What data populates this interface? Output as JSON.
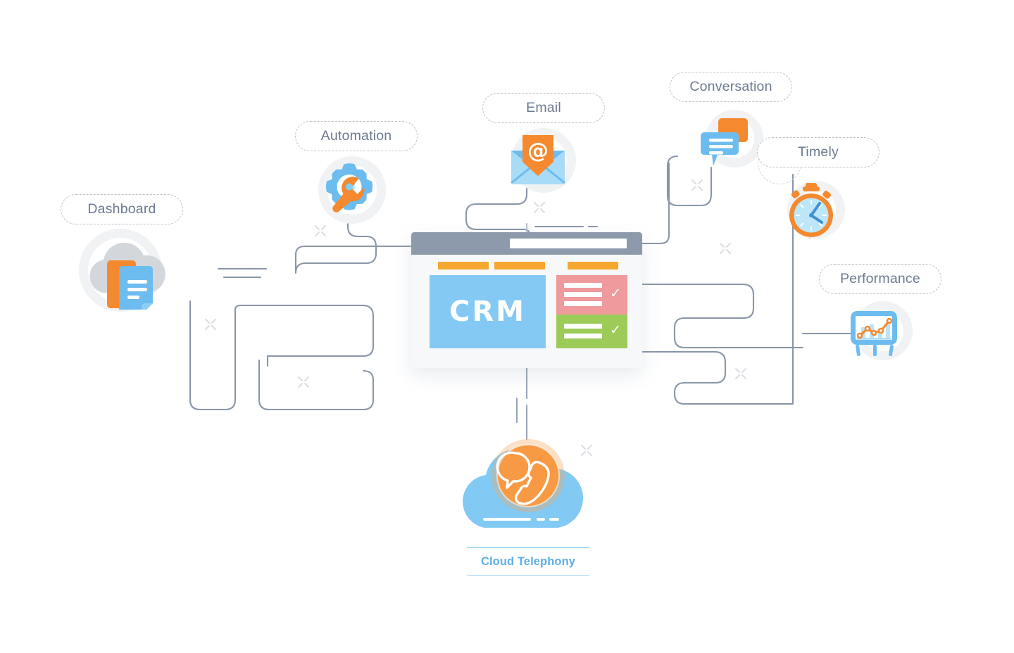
{
  "illustration": {
    "title": "CRM integration concept diagram",
    "center": {
      "app_name": "CRM",
      "window_title_bar": "",
      "address_bar_value": "",
      "tabs": [
        "",
        "",
        ""
      ],
      "panels": [
        {
          "name": "pink-task-card",
          "color": "#ef9a9c",
          "rows": 3,
          "checked": true
        },
        {
          "name": "green-task-card",
          "color": "#9ccb58",
          "rows": 2,
          "checked": true
        }
      ]
    },
    "nodes": [
      {
        "id": "dashboard",
        "label": "Dashboard",
        "icon": "cloud-documents-icon"
      },
      {
        "id": "automation",
        "label": "Automation",
        "icon": "gear-wrench-icon"
      },
      {
        "id": "email",
        "label": "Email",
        "icon": "envelope-at-icon"
      },
      {
        "id": "conversation",
        "label": "Conversation",
        "icon": "chat-bubbles-icon"
      },
      {
        "id": "timely",
        "label": "Timely",
        "icon": "stopwatch-icon"
      },
      {
        "id": "performance",
        "label": "Performance",
        "icon": "chart-easel-icon"
      }
    ],
    "footer": {
      "label": "Cloud Telephony",
      "icon": "cloud-phone-icon"
    },
    "colors": {
      "orange": "#f5892f",
      "orange_light": "#f5a730",
      "blue": "#7dc5f0",
      "blue_light": "#a9d8f6",
      "blue_text": "#5dafe8",
      "slate": "#8d9aab",
      "wire": "#8996a8",
      "pink": "#ef9a9c",
      "green": "#9ccb58",
      "pill_text": "#6b7a8f",
      "pill_border": "#b9bfc9",
      "halo": "#f1f2f4"
    }
  }
}
